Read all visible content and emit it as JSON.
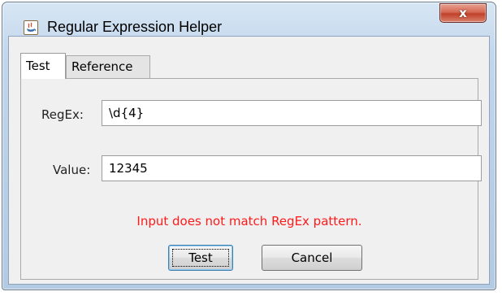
{
  "window": {
    "title": "Regular Expression Helper",
    "close_label": "x"
  },
  "tabs": [
    {
      "label": "Test",
      "selected": true
    },
    {
      "label": "Reference",
      "selected": false
    }
  ],
  "form": {
    "regex_label": "RegEx:",
    "regex_value": "\\d{4}",
    "value_label": "Value:",
    "value_value": "12345"
  },
  "status": {
    "message": "Input does not match RegEx pattern.",
    "color": "#ff1a1a"
  },
  "buttons": {
    "test_label": "Test",
    "cancel_label": "Cancel"
  },
  "icons": {
    "app": "java-app-icon",
    "close": "close-icon"
  }
}
